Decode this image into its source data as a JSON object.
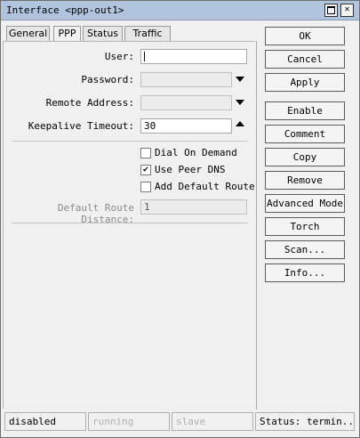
{
  "window": {
    "title": "Interface <ppp-out1>",
    "maximize_icon": "maximize-icon",
    "close_icon": "close-icon",
    "close_glyph": "✕"
  },
  "tabs": [
    {
      "label": "General",
      "active": false
    },
    {
      "label": "PPP",
      "active": true
    },
    {
      "label": "Status",
      "active": false
    },
    {
      "label": "Traffic",
      "active": false
    }
  ],
  "form": {
    "user": {
      "label": "User:",
      "value": ""
    },
    "password": {
      "label": "Password:",
      "value": ""
    },
    "remote_address": {
      "label": "Remote Address:",
      "value": ""
    },
    "keepalive_timeout": {
      "label": "Keepalive Timeout:",
      "value": "30"
    },
    "dial_on_demand": {
      "label": "Dial On Demand",
      "checked": false
    },
    "use_peer_dns": {
      "label": "Use Peer DNS",
      "checked": true
    },
    "add_default_route": {
      "label": "Add Default Route",
      "checked": false
    },
    "default_route_distance": {
      "label": "Default Route Distance:",
      "value": "1"
    }
  },
  "buttons": {
    "ok": "OK",
    "cancel": "Cancel",
    "apply": "Apply",
    "enable": "Enable",
    "comment": "Comment",
    "copy": "Copy",
    "remove": "Remove",
    "advanced_mode": "Advanced Mode",
    "torch": "Torch",
    "scan": "Scan...",
    "info": "Info..."
  },
  "statusbar": {
    "state": "disabled",
    "running": "running",
    "slave": "slave",
    "status": "Status: termin..."
  },
  "icons": {
    "dropdown": "chevron-down-icon",
    "stepper": "chevron-up-icon",
    "checkmark": "✔"
  }
}
